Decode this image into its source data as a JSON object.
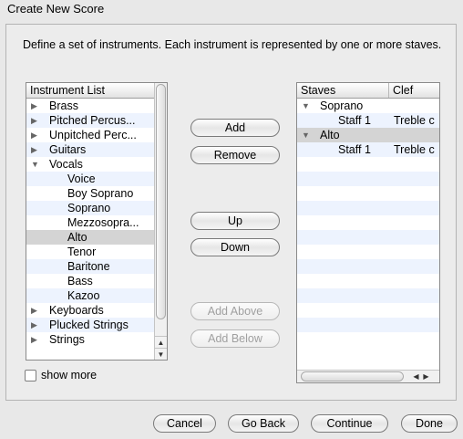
{
  "window": {
    "title": "Create New Score"
  },
  "description": "Define a set of instruments. Each instrument is represented by one or more staves.",
  "instrument_list": {
    "header": "Instrument List",
    "items": [
      {
        "label": "Brass",
        "indent": 0,
        "expander": "collapsed"
      },
      {
        "label": "Pitched Percus...",
        "indent": 0,
        "expander": "collapsed"
      },
      {
        "label": "Unpitched Perc...",
        "indent": 0,
        "expander": "collapsed"
      },
      {
        "label": "Guitars",
        "indent": 0,
        "expander": "collapsed"
      },
      {
        "label": "Vocals",
        "indent": 0,
        "expander": "expanded"
      },
      {
        "label": "Voice",
        "indent": 1,
        "expander": "none"
      },
      {
        "label": "Boy Soprano",
        "indent": 1,
        "expander": "none"
      },
      {
        "label": "Soprano",
        "indent": 1,
        "expander": "none"
      },
      {
        "label": "Mezzosopra...",
        "indent": 1,
        "expander": "none"
      },
      {
        "label": "Alto",
        "indent": 1,
        "expander": "none",
        "selected": true
      },
      {
        "label": "Tenor",
        "indent": 1,
        "expander": "none"
      },
      {
        "label": "Baritone",
        "indent": 1,
        "expander": "none"
      },
      {
        "label": "Bass",
        "indent": 1,
        "expander": "none"
      },
      {
        "label": "Kazoo",
        "indent": 1,
        "expander": "none"
      },
      {
        "label": "Keyboards",
        "indent": 0,
        "expander": "collapsed"
      },
      {
        "label": "Plucked Strings",
        "indent": 0,
        "expander": "collapsed"
      },
      {
        "label": "Strings",
        "indent": 0,
        "expander": "collapsed"
      }
    ]
  },
  "middle_buttons": {
    "add": "Add",
    "remove": "Remove",
    "up": "Up",
    "down": "Down",
    "add_above": "Add Above",
    "add_below": "Add Below"
  },
  "show_more": {
    "label": "show more",
    "checked": false
  },
  "staves_list": {
    "headers": [
      "Staves",
      "Clef"
    ],
    "items": [
      {
        "label": "Soprano",
        "clef": "",
        "indent": 0,
        "expander": "expanded"
      },
      {
        "label": "Staff 1",
        "clef": "Treble c",
        "indent": 1,
        "expander": "none"
      },
      {
        "label": "Alto",
        "clef": "",
        "indent": 0,
        "expander": "expanded",
        "selected": true
      },
      {
        "label": "Staff 1",
        "clef": "Treble c",
        "indent": 1,
        "expander": "none"
      }
    ]
  },
  "footer": {
    "cancel": "Cancel",
    "go_back": "Go Back",
    "continue": "Continue",
    "done": "Done"
  },
  "icons": {
    "collapsed": "disclosure-triangle-right-icon",
    "expanded": "disclosure-triangle-down-icon"
  }
}
